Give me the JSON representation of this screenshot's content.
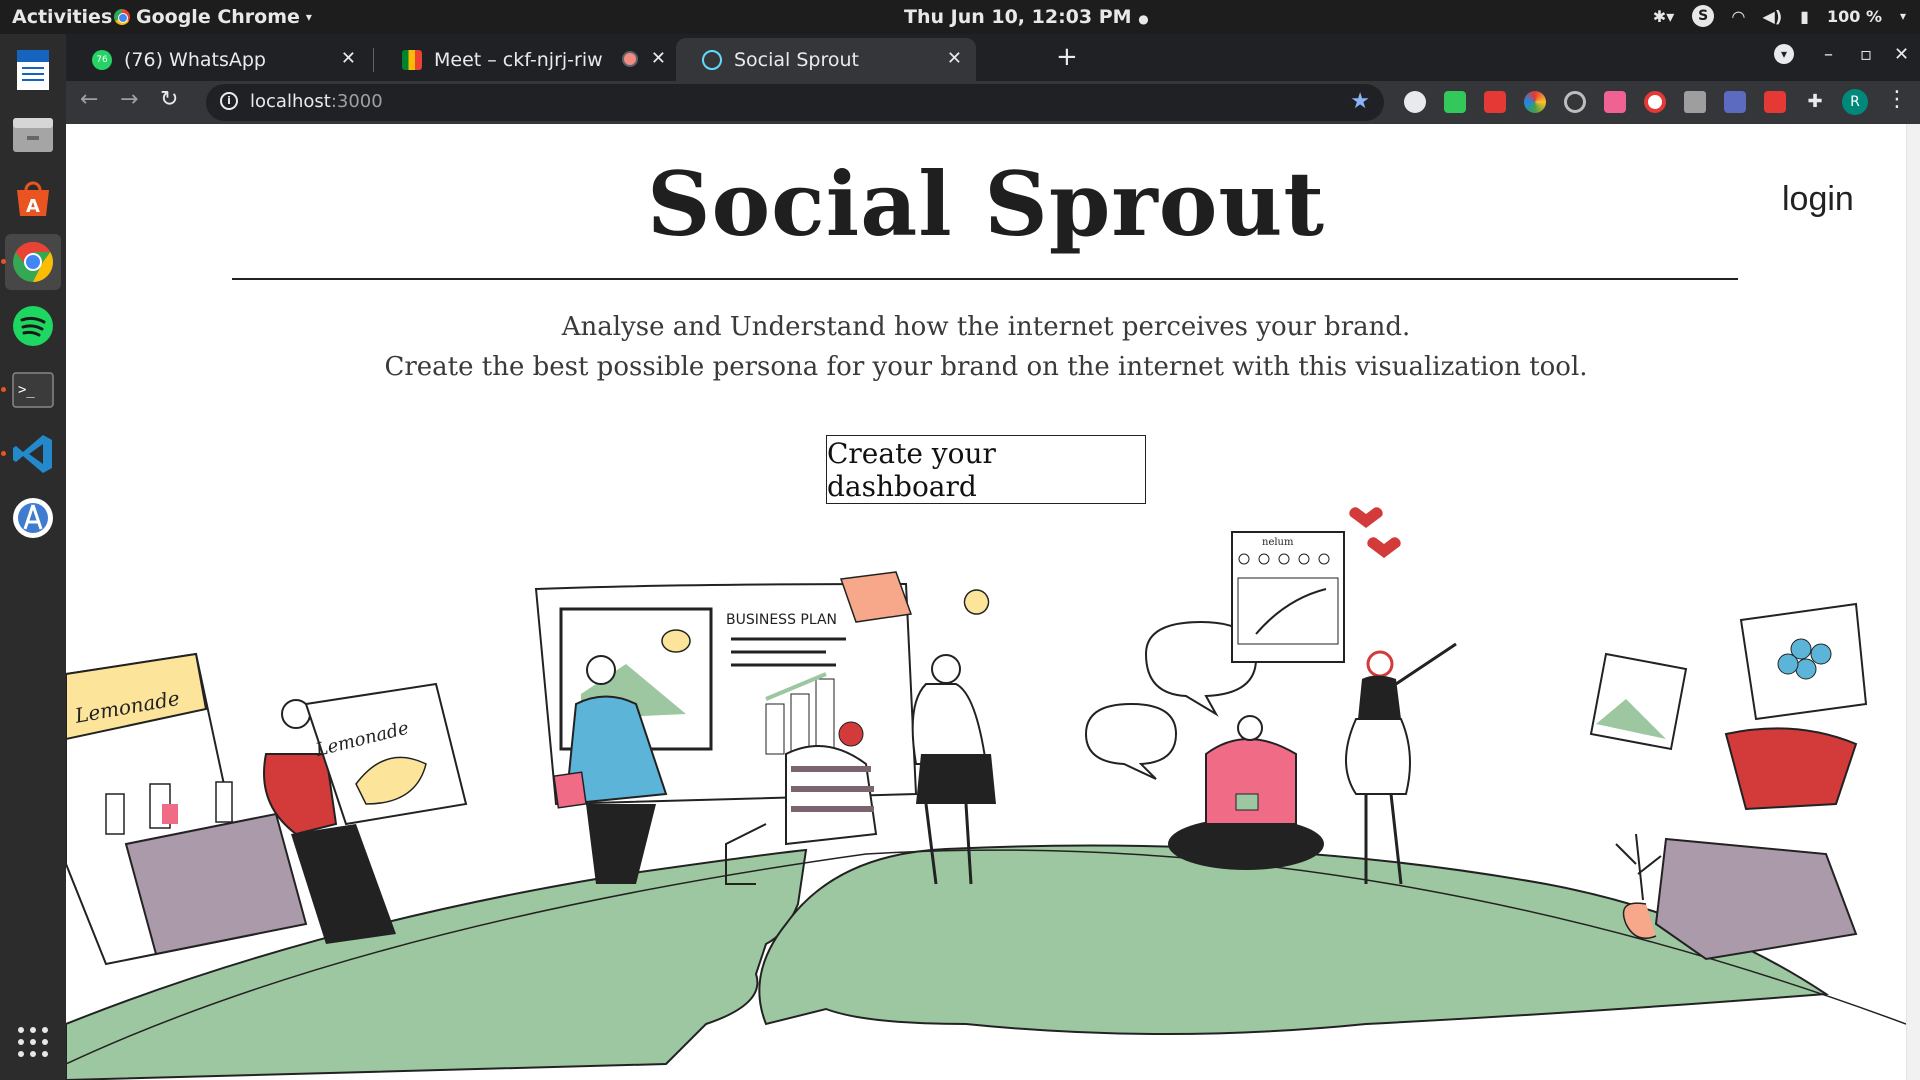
{
  "system": {
    "activities": "Activities",
    "app_name": "Google Chrome",
    "clock": "Thu Jun 10, 12:03 PM",
    "battery": "100 %"
  },
  "browser": {
    "tabs": [
      {
        "label": "(76) WhatsApp",
        "badge": "76"
      },
      {
        "label": "Meet – ckf-njrj-riw"
      },
      {
        "label": "Social Sprout"
      }
    ],
    "url_host": "localhost",
    "url_port": ":3000",
    "profile_initial": "R"
  },
  "page": {
    "title": "Social Sprout",
    "login": "login",
    "tagline_1": "Analyse and Understand how the internet perceives your brand.",
    "tagline_2": "Create the best possible persona for your brand on the internet with this visualization tool.",
    "cta": "Create your dashboard",
    "illustration": {
      "lemonade_sign": "Lemonade",
      "lemonade_poster": "Lemonade",
      "board_label": "BUSINESS PLAN",
      "profile_label": "nelum"
    }
  },
  "colors": {
    "ground": "#9dc7a0",
    "accent_pink": "#f06b86",
    "shirt_blue": "#5db4d9",
    "shirt_red": "#d33b3b",
    "sofa": "#ab9aa9",
    "lemon_yellow": "#fce59a"
  }
}
